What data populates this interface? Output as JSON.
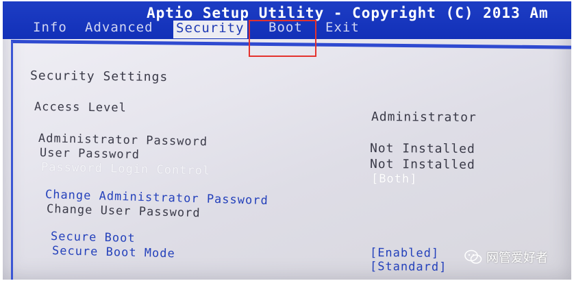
{
  "header": {
    "title": "Aptio Setup Utility - Copyright (C) 2013 Am",
    "tabs": [
      "Info",
      "Advanced",
      "Security",
      "Boot",
      "Exit"
    ],
    "active_tab": "Security",
    "highlighted_tab": "Boot"
  },
  "security": {
    "section_title": "Security Settings",
    "access_level_label": "Access Level",
    "access_level_value": "Administrator",
    "admin_password_label": "Administrator Password",
    "admin_password_value": "Not Installed",
    "user_password_label": "User Password",
    "user_password_value": "Not Installed",
    "password_login_control_label": "Password Login Control",
    "password_login_control_value": "[Both]",
    "change_admin_password_label": "Change Administrator Password",
    "change_user_password_label": "Change User Password",
    "secure_boot_label": "Secure Boot",
    "secure_boot_value": "[Enabled]",
    "secure_boot_mode_label": "Secure Boot Mode",
    "secure_boot_mode_value": "[Standard]"
  },
  "watermark": {
    "text": "网管爱好者",
    "icon": "wechat-icon"
  },
  "colors": {
    "header_bg": "#1230b8",
    "highlight_box": "#e4322d",
    "option_text": "#2441bb"
  }
}
